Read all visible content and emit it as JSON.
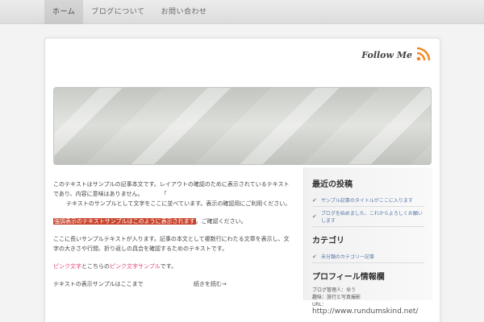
{
  "nav": {
    "items": [
      {
        "label": "ホーム",
        "active": true
      },
      {
        "label": "ブログについて",
        "active": false
      },
      {
        "label": "お問い合わせ",
        "active": false
      }
    ]
  },
  "header": {
    "follow_label": "Follow Me",
    "rss_icon": "rss-icon"
  },
  "main": {
    "para1": "このテキストはサンプルの記事本文です。レイアウトの確認のために表示されているテキストであり、内容に意味はありません。",
    "para1_mark": "「",
    "para1_cont": "テキストのサンプルとして文字をここに並べています。表示の確認用にご利用ください。",
    "highlight_text": "強調表示のテキストサンプルはこのように表示されます",
    "highlight_suffix": "。ご確認ください。",
    "para3": "ここに長いサンプルテキストが入ります。記事の本文として複数行にわたる文章を表示し、文字の大きさや行間、折り返しの具合を確認するためのテキストです。",
    "pink1": "ピンク文字",
    "mid1": "とこちらの",
    "pink2": "ピンク文字サンプル",
    "mid2": "です。",
    "bottom_left": "テキストの表示サンプルはここまで",
    "bottom_right": "続きを読む→"
  },
  "sidebar": {
    "section1_title": "最近の投稿",
    "section1_items": [
      "サンプル記事のタイトルがここに入ります",
      "ブログを始めました、これからよろしくお願いします"
    ],
    "section2_title": "カテゴリ",
    "section2_items": [
      "未分類のカテゴリー記事"
    ],
    "section3_title": "プロフィール情報欄",
    "profile_line1": "ブログ管理人：ゆう",
    "profile_line2": "趣味：旅行と写真撮影",
    "profile_url_label": "URL：",
    "profile_url": "http://www.rundumskind.net/"
  }
}
